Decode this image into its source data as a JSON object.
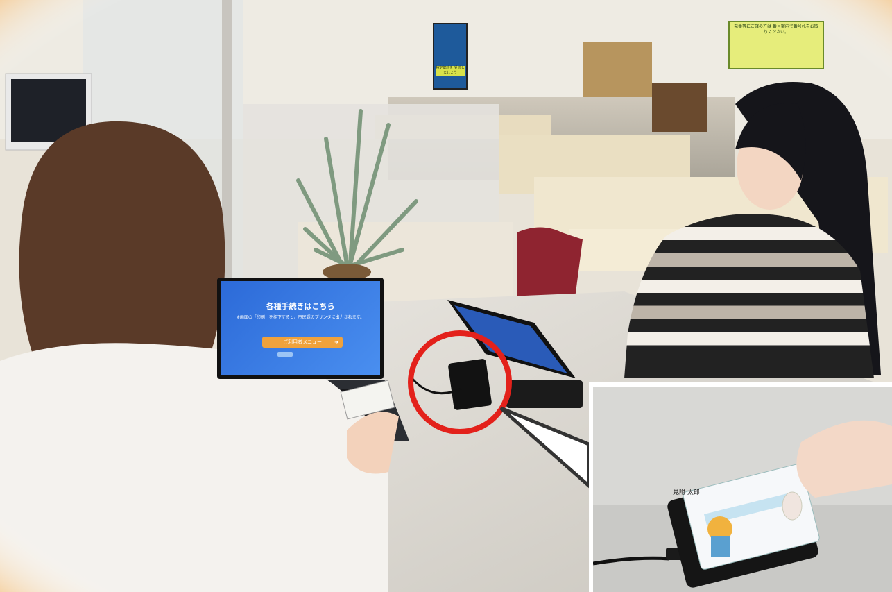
{
  "laptop": {
    "title": "各種手続きはこちら",
    "body": "※画面の「印刷」を押下すると、市民課のプリンタに出力されます。",
    "button": "ご利用者メニュー",
    "button_icon": "arrow-right-icon"
  },
  "sign": {
    "text": "発番等にご確の方は 番号案内で番号札をお取りください。"
  },
  "poster": {
    "text": "特定健診を 受診しましょう"
  },
  "inset_card": {
    "name": "見附 太郎"
  },
  "colors": {
    "highlight_ring": "#e3211b",
    "laptop_screen": "#2c6ad8",
    "frame_glow": "#f5a33a"
  }
}
